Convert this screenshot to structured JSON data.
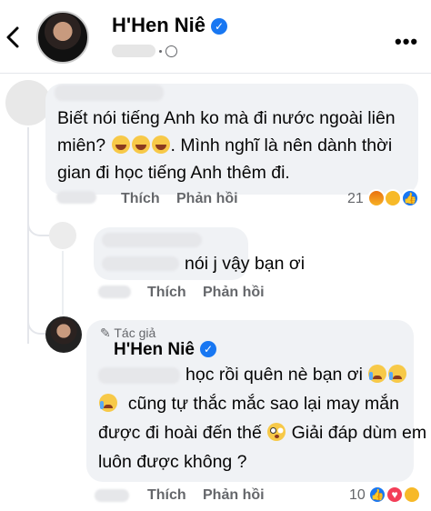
{
  "header": {
    "name": "H'Hen Niê",
    "verified_mark": "✓",
    "more_icon": "•••"
  },
  "comment1": {
    "lines": [
      "Biết nói tiếng Anh ko mà đi nước ngoài liên",
      "miên?",
      ". Mình nghĩ là nên dành thời",
      "gian đi học tiếng Anh thêm đi."
    ],
    "like_label": "Thích",
    "reply_label": "Phản hồi",
    "reaction_count": "21"
  },
  "comment2": {
    "text": "nói j vậy bạn ơi",
    "like_label": "Thích",
    "reply_label": "Phản hồi"
  },
  "comment3": {
    "badge": "Tác giả",
    "name": "H'Hen Niê",
    "lines": [
      "học rồi quên nè bạn ơi",
      "cũng tự thắc mắc sao lại may mắn",
      "được đi hoài đến thế",
      "Giải đáp dùm em",
      "luôn được không ?"
    ],
    "like_label": "Thích",
    "reply_label": "Phản hồi",
    "reaction_count": "10"
  },
  "colors": {
    "verified": "#1877f2",
    "bubble": "#f0f2f5",
    "muted_text": "#65676b"
  }
}
